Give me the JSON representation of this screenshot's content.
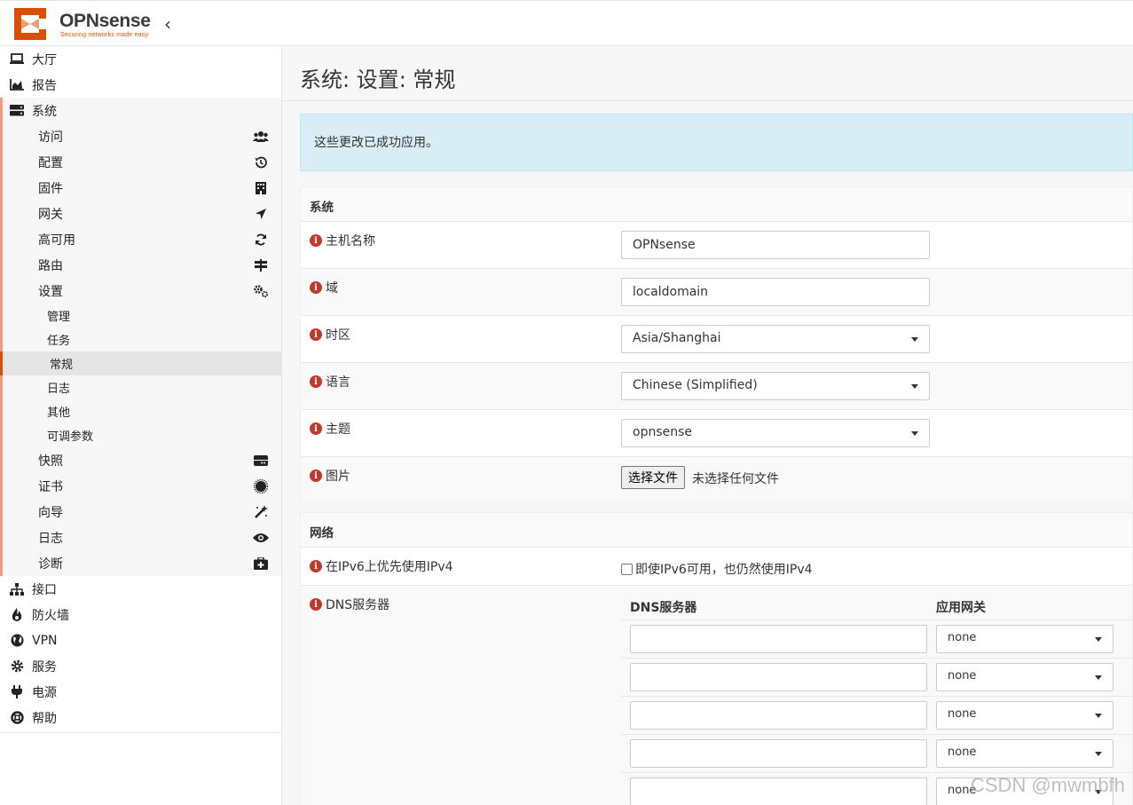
{
  "brand": {
    "name": "OPNsense",
    "tagline": "Securing networks made easy"
  },
  "page_title": "系统: 设置: 常规",
  "alert_text": "这些更改已成功应用。",
  "sidebar": {
    "top_items": [
      {
        "label": "大厅",
        "icon": "laptop-icon"
      },
      {
        "label": "报告",
        "icon": "area-chart-icon"
      }
    ],
    "system": {
      "label": "系统",
      "icon": "server-icon",
      "sub": [
        {
          "label": "访问",
          "icon": "users-icon"
        },
        {
          "label": "配置",
          "icon": "history-icon"
        },
        {
          "label": "固件",
          "icon": "building-icon"
        },
        {
          "label": "网关",
          "icon": "location-arrow-icon"
        },
        {
          "label": "高可用",
          "icon": "refresh-icon"
        },
        {
          "label": "路由",
          "icon": "signpost-icon"
        },
        {
          "label": "设置",
          "icon": "cogs-icon"
        }
      ],
      "settings_children": [
        "管理",
        "任务",
        "常规",
        "日志",
        "其他",
        "可调参数"
      ],
      "sub2": [
        {
          "label": "快照",
          "icon": "hdd-icon"
        },
        {
          "label": "证书",
          "icon": "certificate-icon"
        },
        {
          "label": "向导",
          "icon": "magic-icon"
        },
        {
          "label": "日志",
          "icon": "eye-icon"
        },
        {
          "label": "诊断",
          "icon": "medkit-icon"
        }
      ]
    },
    "bottom_items": [
      {
        "label": "接口",
        "icon": "sitemap-icon"
      },
      {
        "label": "防火墙",
        "icon": "fire-icon"
      },
      {
        "label": "VPN",
        "icon": "globe-icon"
      },
      {
        "label": "服务",
        "icon": "cog-icon"
      },
      {
        "label": "电源",
        "icon": "plug-icon"
      },
      {
        "label": "帮助",
        "icon": "life-ring-icon"
      }
    ]
  },
  "system_section": {
    "heading": "系统",
    "hostname": {
      "label": "主机名称",
      "value": "OPNsense"
    },
    "domain": {
      "label": "域",
      "value": "localdomain"
    },
    "timezone": {
      "label": "时区",
      "value": "Asia/Shanghai"
    },
    "language": {
      "label": "语言",
      "value": "Chinese (Simplified)"
    },
    "theme": {
      "label": "主题",
      "value": "opnsense"
    },
    "image": {
      "label": "图片",
      "button": "选择文件",
      "status": "未选择任何文件"
    }
  },
  "network_section": {
    "heading": "网络",
    "prefer_ipv4": {
      "label": "在IPv6上优先使用IPv4",
      "checkbox_text": "即使IPv6可用，也仍然使用IPv4"
    },
    "dns": {
      "label": "DNS服务器",
      "col_server": "DNS服务器",
      "col_gateway": "应用网关",
      "rows": [
        {
          "server": "",
          "gateway": "none"
        },
        {
          "server": "",
          "gateway": "none"
        },
        {
          "server": "",
          "gateway": "none"
        },
        {
          "server": "",
          "gateway": "none"
        },
        {
          "server": "",
          "gateway": "none"
        }
      ]
    }
  },
  "watermark": "CSDN @mwmbfh"
}
